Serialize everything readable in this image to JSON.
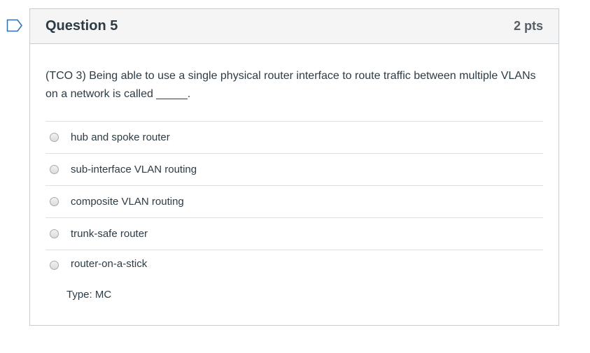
{
  "question": {
    "title": "Question 5",
    "points": "2 pts",
    "text": "(TCO 3) Being able to use a single physical router interface to route traffic between multiple VLANs on a network is called _____.",
    "answers": [
      {
        "label": "hub and spoke router"
      },
      {
        "label": "sub-interface VLAN routing"
      },
      {
        "label": "composite VLAN routing"
      },
      {
        "label": "trunk-safe router"
      },
      {
        "label": "router-on-a-stick"
      }
    ],
    "type_label": "Type: MC"
  },
  "icons": {
    "flag": "bookmark-flag-icon"
  },
  "colors": {
    "flag_outline": "#2f6fb1",
    "header_bg": "#f5f5f5",
    "border": "#c7cdd1",
    "text": "#2d3b45"
  }
}
